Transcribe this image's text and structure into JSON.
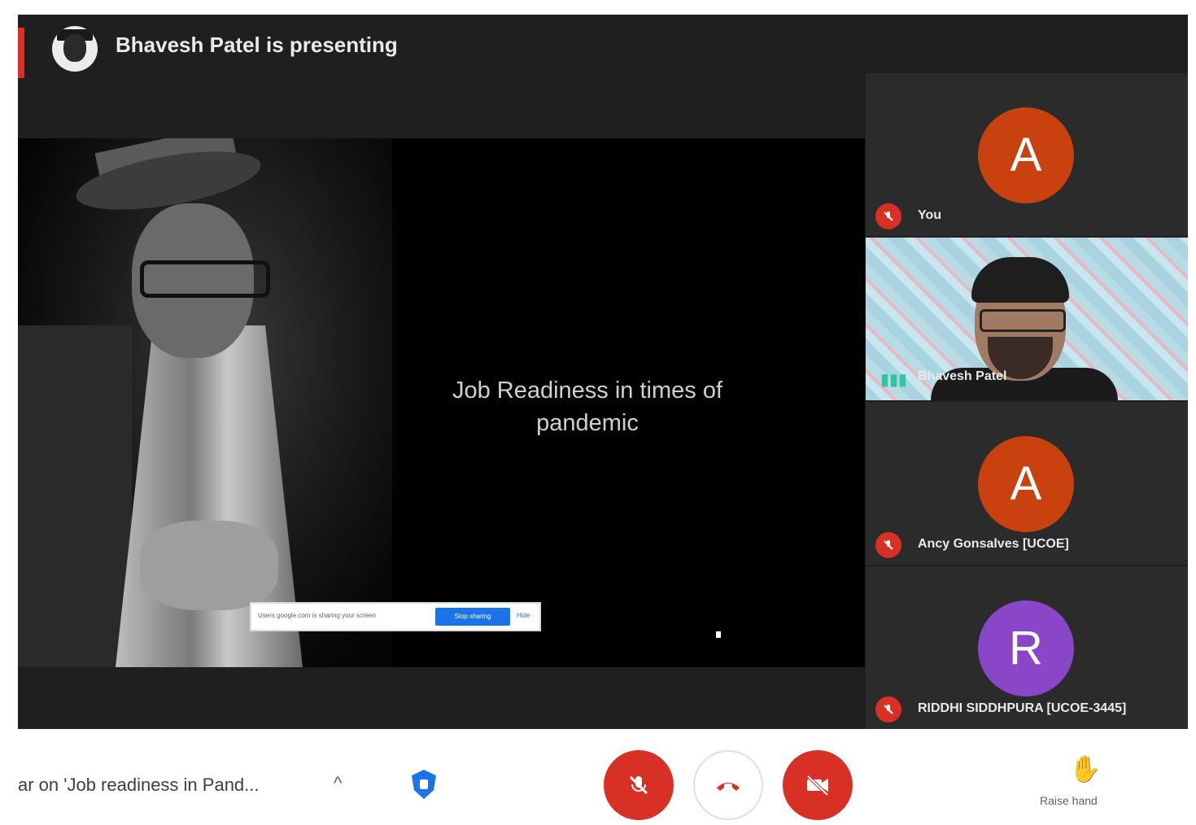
{
  "header": {
    "presenter_title": "Bhavesh Patel is presenting"
  },
  "slide": {
    "title": "Job Readiness in times of pandemic",
    "notice": {
      "text": "Users google.com is sharing your screen",
      "button": "Stop sharing",
      "hide": "Hide"
    }
  },
  "participants": [
    {
      "name": "You",
      "initial": "A",
      "color": "#c8410f",
      "muted": true
    },
    {
      "name": "Bhavesh Patel",
      "video": true,
      "speaking": true
    },
    {
      "name": "Ancy Gonsalves [UCOE]",
      "initial": "A",
      "color": "#c8410f",
      "muted": true
    },
    {
      "name": "RIDDHI SIDDHPURA [UCOE-3445]",
      "initial": "R",
      "color": "#8a46c8",
      "muted": true
    }
  ],
  "bottom_bar": {
    "meeting_name": "ar on 'Job readiness in Pand...",
    "raise_hand_label": "Raise hand"
  },
  "icons": {
    "mic_off": "mic-off-icon",
    "hang_up": "hang-up-icon",
    "camera_off": "camera-off-icon",
    "shield": "shield-icon",
    "hand": "hand-icon"
  }
}
